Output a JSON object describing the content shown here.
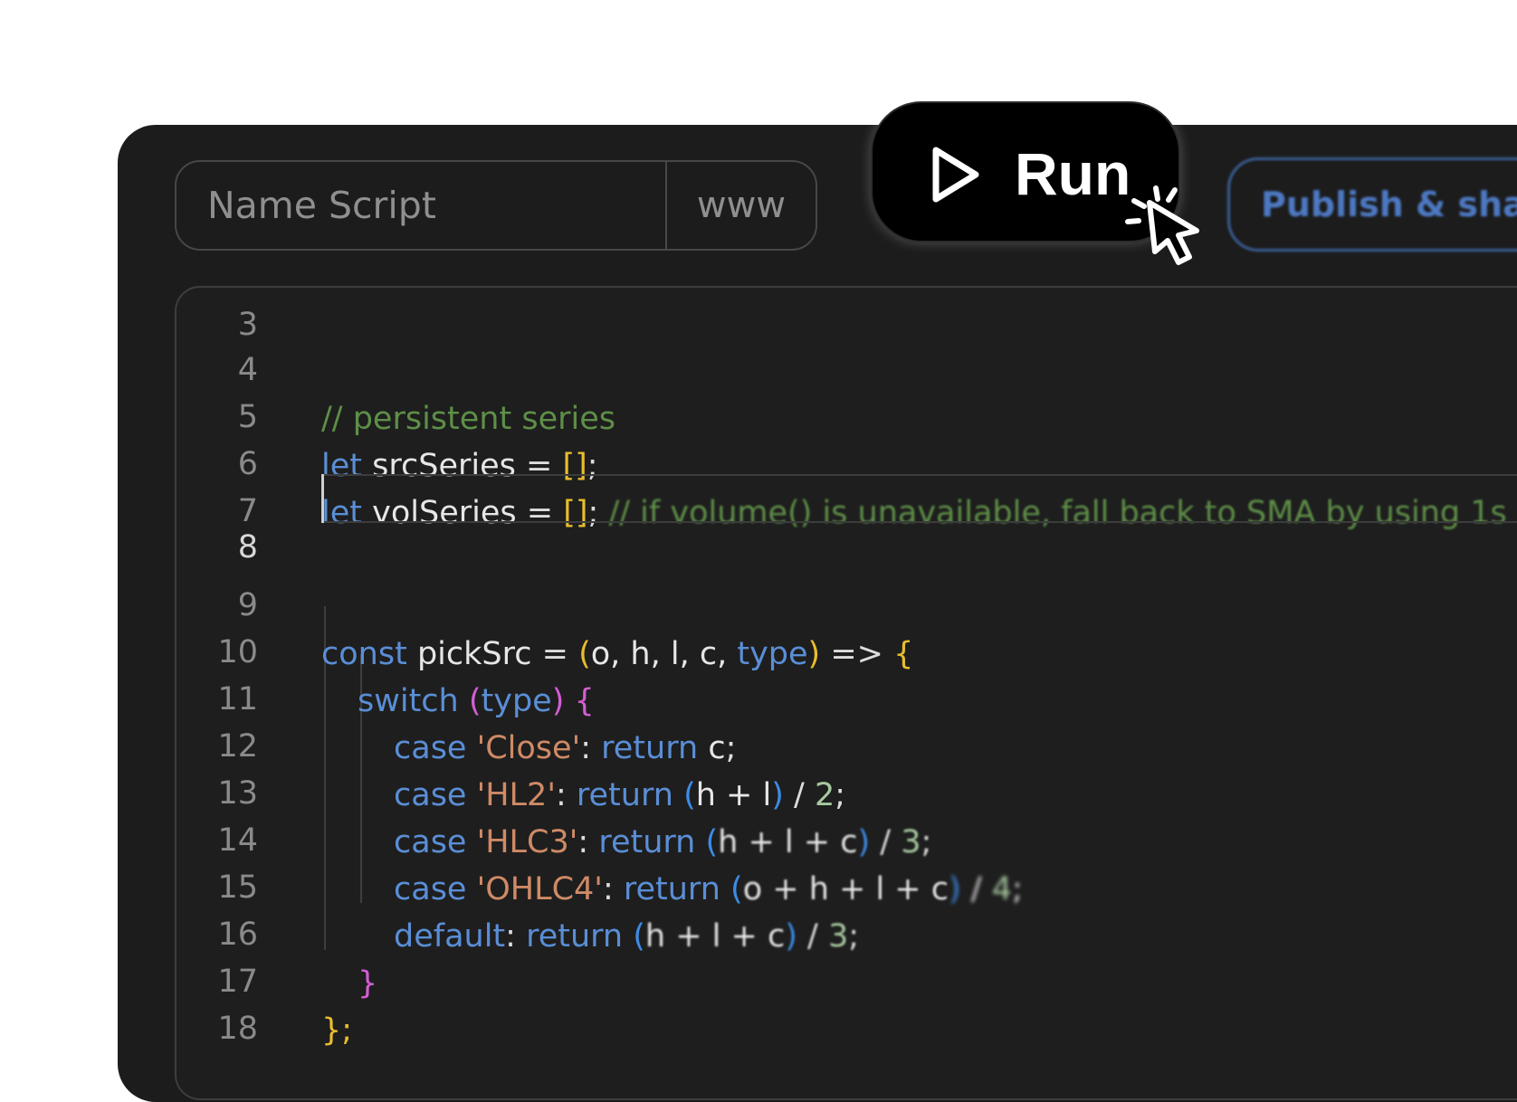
{
  "toolbar": {
    "name_placeholder": "Name Script",
    "name_suffix": "www",
    "run_label": "Run",
    "publish_label": "Publish & shar"
  },
  "editor": {
    "partial_top_line": "3",
    "lines": [
      {
        "num": "4"
      },
      {
        "num": "5"
      },
      {
        "num": "6"
      },
      {
        "num": "7"
      },
      {
        "num": "8"
      },
      {
        "num": "9"
      },
      {
        "num": "10"
      },
      {
        "num": "11"
      },
      {
        "num": "12"
      },
      {
        "num": "13"
      },
      {
        "num": "14"
      },
      {
        "num": "15"
      },
      {
        "num": "16"
      },
      {
        "num": "17"
      },
      {
        "num": "18"
      }
    ],
    "tokens": {
      "l4_comment": "// persistent series",
      "kw_let": "let",
      "l5_name": "srcSeries",
      "assign": "=",
      "brackets": "[]",
      "semi": ";",
      "l6_name": "volSeries",
      "l6_comment": "// if volume() is unavailable, fall back to SMA by using 1s",
      "kw_const": "const",
      "l9_name": "pickSrc",
      "paren_open": "(",
      "params": "o, h, l, c, ",
      "param_type": "type",
      "paren_close": ")",
      "arrow": "=>",
      "brace_open": "{",
      "kw_switch": "switch",
      "kw_case": "case",
      "kw_return": "return",
      "kw_default": "default",
      "str_close": "'Close'",
      "str_hl2": "'HL2'",
      "str_hlc3": "'HLC3'",
      "str_ohlc4": "'OHLC4'",
      "colon": ":",
      "var_c": "c",
      "expr_hl": "h + l",
      "expr_hlc": "h + l + c",
      "expr_ohlc": "o + h + l + c",
      "div": "/",
      "num2": "2",
      "num3": "3",
      "num4": "4",
      "brace_close": "}",
      "brace_close_semi": "};"
    }
  }
}
